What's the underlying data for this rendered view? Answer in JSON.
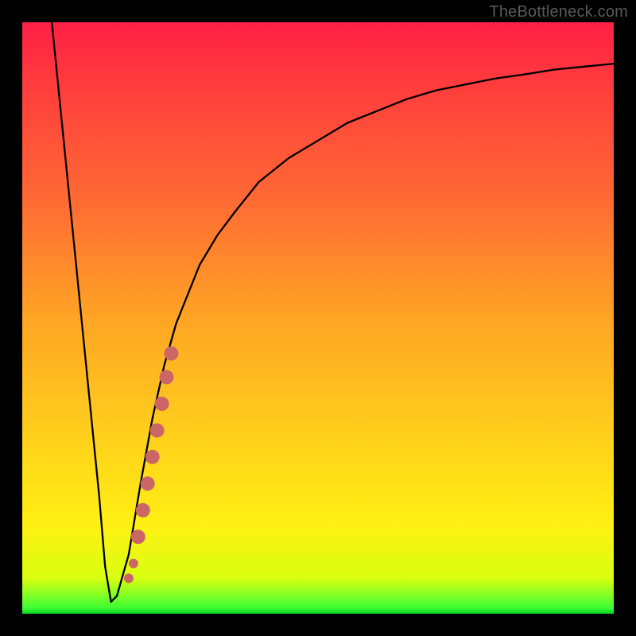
{
  "attribution": "TheBottleneck.com",
  "chart_data": {
    "type": "line",
    "title": "",
    "xlabel": "",
    "ylabel": "",
    "xlim": [
      0,
      100
    ],
    "ylim": [
      0,
      100
    ],
    "series": [
      {
        "name": "bottleneck-curve",
        "x": [
          5,
          7,
          9,
          11,
          13,
          14,
          15,
          16,
          18,
          20,
          22,
          24,
          26,
          28,
          30,
          33,
          36,
          40,
          45,
          50,
          55,
          60,
          65,
          70,
          75,
          80,
          85,
          90,
          95,
          100
        ],
        "y": [
          100,
          80,
          60,
          40,
          20,
          8,
          2,
          3,
          10,
          22,
          33,
          42,
          49,
          54,
          59,
          64,
          68,
          73,
          77,
          80,
          83,
          85,
          87,
          88.5,
          89.5,
          90.5,
          91.2,
          92,
          92.5,
          93
        ]
      }
    ],
    "markers": {
      "name": "highlight-segment",
      "color": "#cc6666",
      "points": [
        {
          "x": 18.0,
          "y": 6.0
        },
        {
          "x": 18.8,
          "y": 8.5
        },
        {
          "x": 19.6,
          "y": 13.0
        },
        {
          "x": 20.4,
          "y": 17.5
        },
        {
          "x": 21.2,
          "y": 22.0
        },
        {
          "x": 22.0,
          "y": 26.5
        },
        {
          "x": 22.8,
          "y": 31.0
        },
        {
          "x": 23.6,
          "y": 35.5
        },
        {
          "x": 24.4,
          "y": 40.0
        },
        {
          "x": 25.2,
          "y": 44.0
        }
      ]
    },
    "background": {
      "type": "vertical-gradient",
      "stops": [
        {
          "pos": 0.0,
          "color": "#ff1f46"
        },
        {
          "pos": 0.5,
          "color": "#ffa424"
        },
        {
          "pos": 0.85,
          "color": "#fff013"
        },
        {
          "pos": 0.99,
          "color": "#3fff33"
        },
        {
          "pos": 1.0,
          "color": "#07d41f"
        }
      ]
    }
  }
}
